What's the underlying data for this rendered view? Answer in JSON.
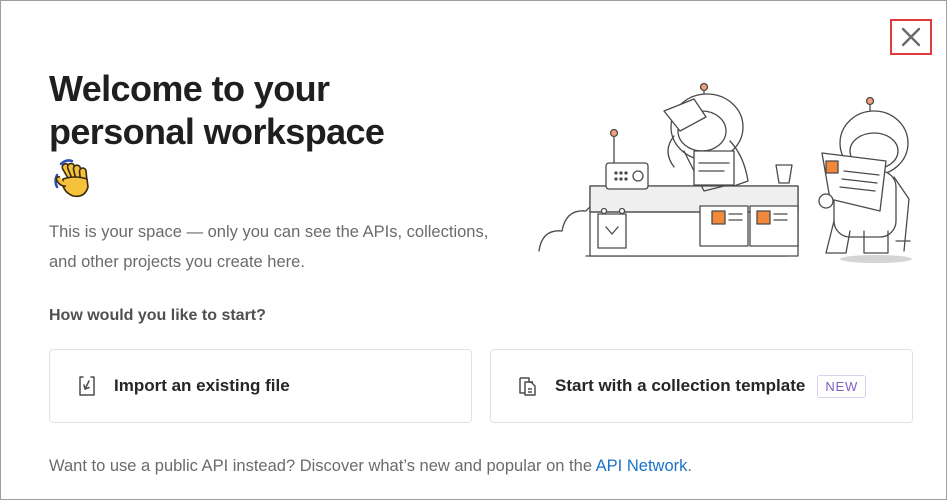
{
  "dialog": {
    "title_line1": "Welcome to your",
    "title_line2": "personal workspace",
    "wave_emoji": "waving-hand",
    "subtitle": "This is your space — only you can see the APIs, collections, and other projects you create here.",
    "question": "How would you like to start?",
    "close_icon": "close-icon"
  },
  "options": [
    {
      "label": "Import an existing file",
      "icon": "import-file-icon"
    },
    {
      "label": "Start with a collection template",
      "icon": "template-icon",
      "badge": "NEW"
    }
  ],
  "footer": {
    "text": "Want to use a public API instead? Discover what’s new and popular on the ",
    "link": "API Network",
    "end": "."
  },
  "colors": {
    "close_highlight": "#e03c3c",
    "link": "#1b73c8",
    "badge": "#7d5fc1",
    "illustration_accent": "#f2893a"
  }
}
